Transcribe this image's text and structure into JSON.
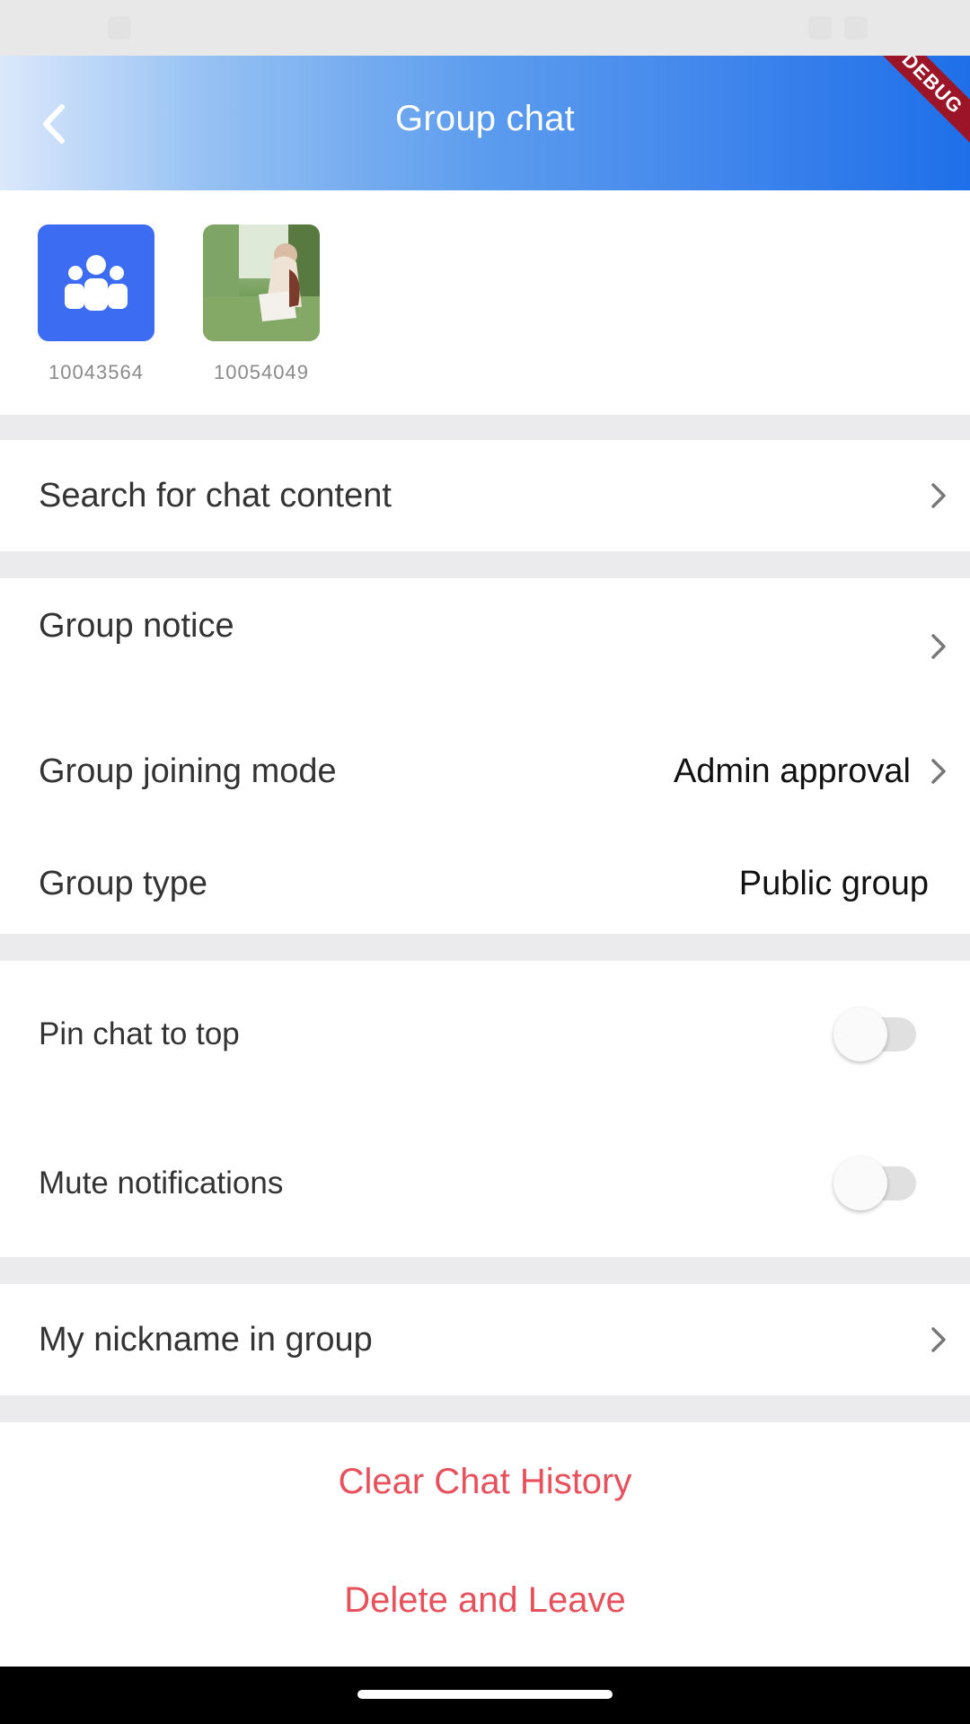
{
  "appbar": {
    "title": "Group chat",
    "debug_banner": "DEBUG"
  },
  "members": [
    {
      "id": "10043564",
      "avatar": "group-icon",
      "color": "#3b6cf2"
    },
    {
      "id": "10054049",
      "avatar": "photo"
    }
  ],
  "search": {
    "label": "Search for chat content"
  },
  "group_info": {
    "notice_label": "Group notice",
    "joining_mode_label": "Group joining mode",
    "joining_mode_value": "Admin approval",
    "type_label": "Group type",
    "type_value": "Public group"
  },
  "toggles": {
    "pin_label": "Pin chat to top",
    "pin_on": false,
    "mute_label": "Mute notifications",
    "mute_on": false
  },
  "nickname": {
    "label": "My nickname in group"
  },
  "actions": {
    "clear_label": "Clear Chat History",
    "delete_label": "Delete and Leave",
    "danger_color": "#e8505b"
  }
}
